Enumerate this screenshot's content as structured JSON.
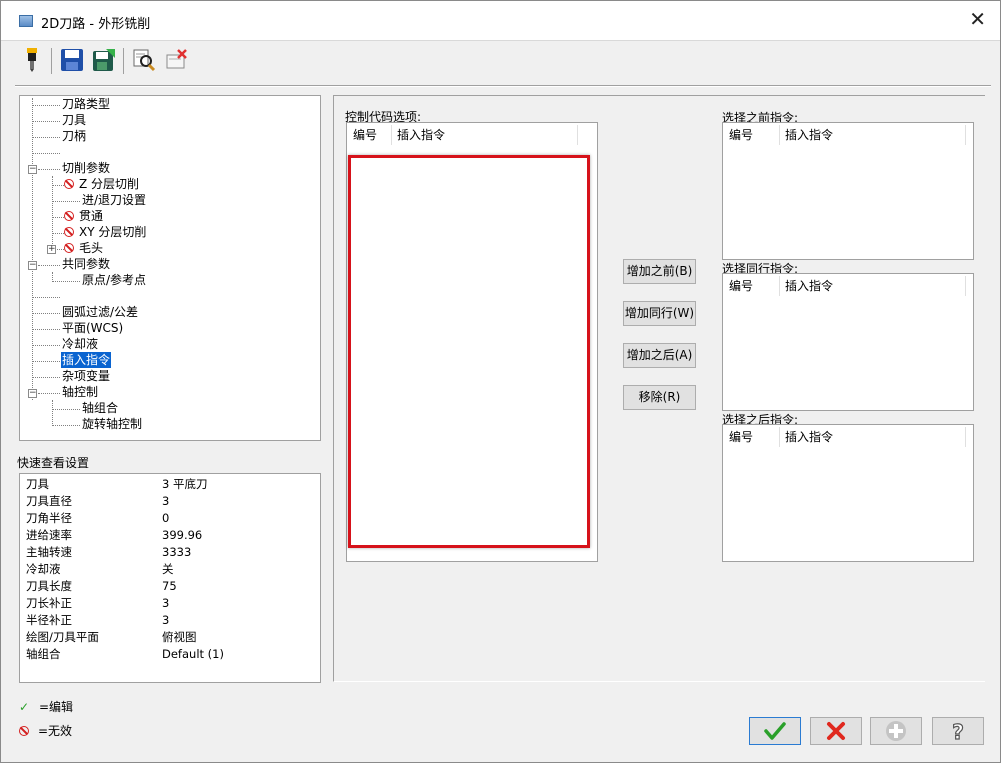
{
  "window": {
    "title": "2D刀路 - 外形铣削",
    "close_glyph": "✕"
  },
  "toolbar": {
    "buttons": [
      {
        "name": "tool-icon"
      },
      {
        "name": "save-icon"
      },
      {
        "name": "save-as-icon"
      },
      {
        "name": "preview-icon"
      },
      {
        "name": "delete-icon"
      }
    ]
  },
  "tree": {
    "items": [
      {
        "label": "刀路类型",
        "level": 0,
        "status": "none"
      },
      {
        "label": "刀具",
        "level": 0,
        "status": "none"
      },
      {
        "label": "刀柄",
        "level": 0,
        "status": "none"
      },
      {
        "label": "",
        "level": 0,
        "status": "none"
      },
      {
        "label": "切削参数",
        "level": 0,
        "status": "none",
        "expander": "−"
      },
      {
        "label": "Z 分层切削",
        "level": 1,
        "status": "disabled"
      },
      {
        "label": "进/退刀设置",
        "level": 1,
        "status": "none"
      },
      {
        "label": "贯通",
        "level": 1,
        "status": "disabled"
      },
      {
        "label": "XY 分层切削",
        "level": 1,
        "status": "disabled"
      },
      {
        "label": "毛头",
        "level": 1,
        "status": "disabled",
        "expander": "+"
      },
      {
        "label": "共同参数",
        "level": 0,
        "status": "none",
        "expander": "−"
      },
      {
        "label": "原点/参考点",
        "level": 1,
        "status": "none"
      },
      {
        "label": "",
        "level": 0,
        "status": "none"
      },
      {
        "label": "圆弧过滤/公差",
        "level": 0,
        "status": "none"
      },
      {
        "label": "平面(WCS)",
        "level": 0,
        "status": "none"
      },
      {
        "label": "冷却液",
        "level": 0,
        "status": "none"
      },
      {
        "label": "插入指令",
        "level": 0,
        "status": "none",
        "selected": true
      },
      {
        "label": "杂项变量",
        "level": 0,
        "status": "none"
      },
      {
        "label": "轴控制",
        "level": 0,
        "status": "none",
        "expander": "−"
      },
      {
        "label": "轴组合",
        "level": 1,
        "status": "none"
      },
      {
        "label": "旋转轴控制",
        "level": 1,
        "status": "none"
      }
    ]
  },
  "quick_view": {
    "label": "快速查看设置",
    "rows": [
      {
        "key": "刀具",
        "value": "3 平底刀"
      },
      {
        "key": "刀具直径",
        "value": "3"
      },
      {
        "key": "刀角半径",
        "value": "0"
      },
      {
        "key": "进给速率",
        "value": "399.96"
      },
      {
        "key": "主轴转速",
        "value": "3333"
      },
      {
        "key": "冷却液",
        "value": "关"
      },
      {
        "key": "刀具长度",
        "value": "75"
      },
      {
        "key": "刀长补正",
        "value": "3"
      },
      {
        "key": "半径补正",
        "value": "3"
      },
      {
        "key": "绘图/刀具平面",
        "value": "俯视图"
      },
      {
        "key": "轴组合",
        "value": "Default (1)"
      }
    ]
  },
  "legend": {
    "edit": {
      "glyph": "✓",
      "label": "=编辑"
    },
    "disabled": {
      "label": "=无效"
    }
  },
  "control_codes": {
    "label": "控制代码选项:",
    "col_number": "编号",
    "col_insert": "插入指令"
  },
  "before_list": {
    "label": "选择之前指令:",
    "col_number": "编号",
    "col_insert": "插入指令"
  },
  "same_list": {
    "label": "选择同行指令:",
    "col_number": "编号",
    "col_insert": "插入指令"
  },
  "after_list": {
    "label": "选择之后指令:",
    "col_number": "编号",
    "col_insert": "插入指令"
  },
  "buttons": {
    "add_before": "增加之前(B)",
    "add_same": "增加同行(W)",
    "add_after": "增加之后(A)",
    "remove": "移除(R)"
  },
  "bottom_buttons": [
    {
      "name": "ok-button",
      "icon": "check-icon",
      "color": "#2aa02a"
    },
    {
      "name": "cancel-button",
      "icon": "cross-icon",
      "color": "#e0281e"
    },
    {
      "name": "add-button",
      "icon": "plus-circle-icon",
      "color": "#b0b0b0"
    },
    {
      "name": "help-button",
      "icon": "help-icon",
      "color": "#555555"
    }
  ]
}
